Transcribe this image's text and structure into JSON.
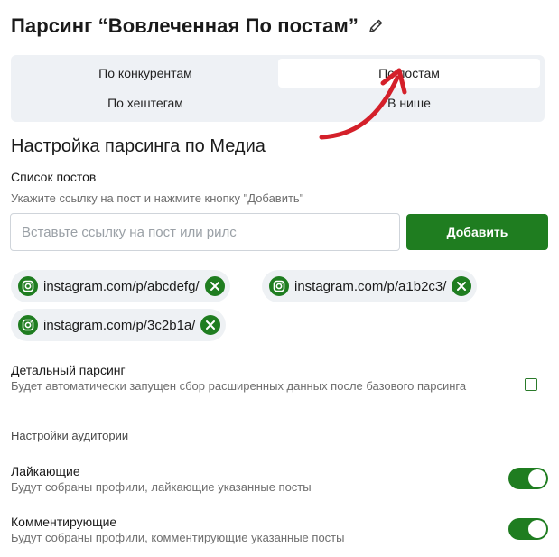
{
  "header": {
    "title": "Парсинг “Вовлеченная По постам”",
    "edit_icon": "pencil-icon"
  },
  "tabs": [
    {
      "label": "По конкурентам",
      "active": false
    },
    {
      "label": "По постам",
      "active": true
    },
    {
      "label": "По хештегам",
      "active": false
    },
    {
      "label": "В нише",
      "active": false
    }
  ],
  "settings": {
    "section_title": "Настройка парсинга по Медиа",
    "posts_label": "Список постов",
    "posts_hint": "Укажите ссылку на пост и нажмите кнопку \"Добавить\"",
    "input_placeholder": "Вставьте ссылку на пост или рилс",
    "input_value": "",
    "add_button": "Добавить"
  },
  "posts": [
    {
      "url": "instagram.com/p/abcdefg/",
      "icon": "instagram-icon"
    },
    {
      "url": "instagram.com/p/a1b2c3/",
      "icon": "instagram-icon"
    },
    {
      "url": "instagram.com/p/3c2b1a/",
      "icon": "instagram-icon"
    }
  ],
  "detailed": {
    "label": "Детальный парсинг",
    "description": "Будет автоматически запущен сбор расширенных данных после базового парсинга",
    "checked": false
  },
  "audience": {
    "title": "Настройки аудитории",
    "likers": {
      "label": "Лайкающие",
      "description": "Будут собраны профили, лайкающие указанные посты",
      "enabled": true
    },
    "commenters": {
      "label": "Комментирующие",
      "description": "Будут собраны профили, комментирующие указанные посты",
      "enabled": true
    }
  },
  "colors": {
    "accent": "#1f7d20",
    "annotation_arrow": "#d4202a",
    "chip_background": "#eef1f4",
    "tabs_background": "#eef1f5"
  }
}
